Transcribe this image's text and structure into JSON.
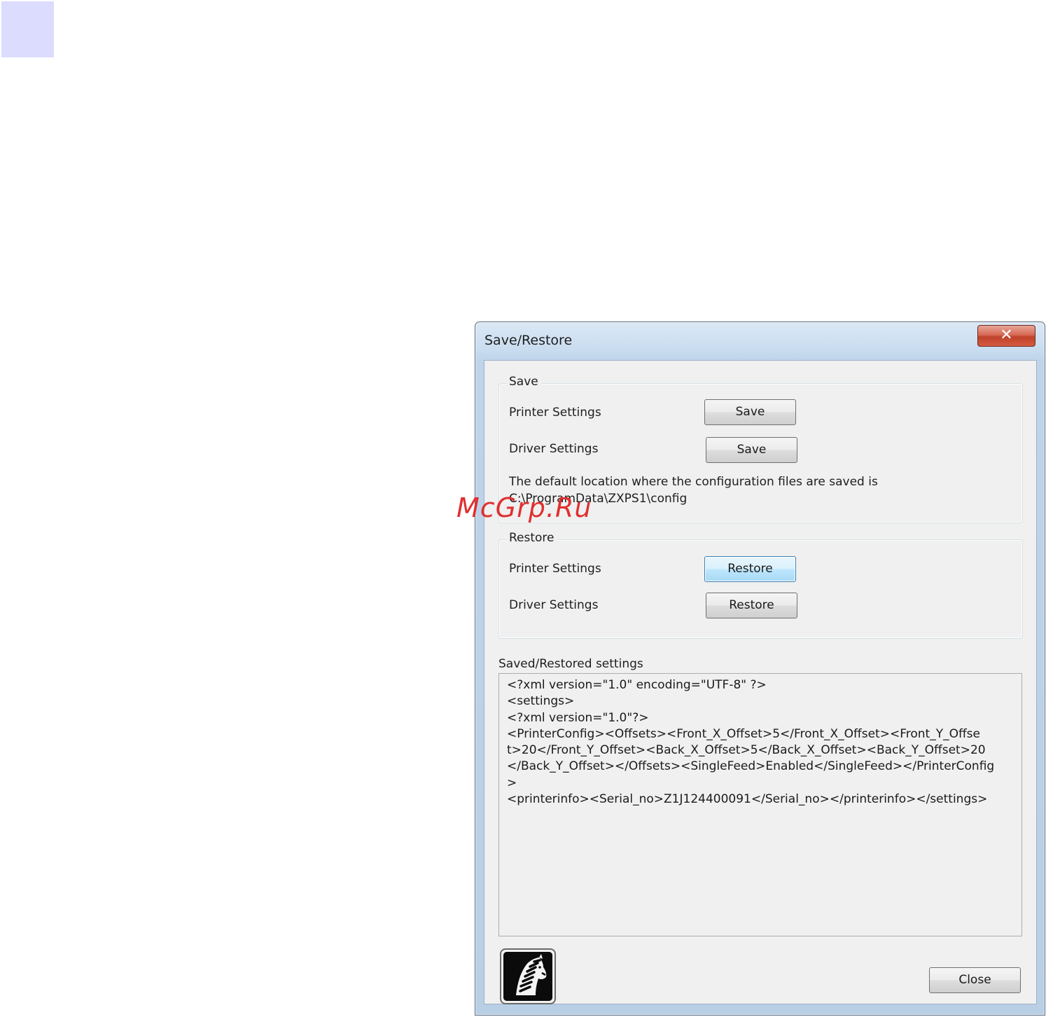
{
  "window": {
    "title": "Save/Restore",
    "close_glyph": "✕"
  },
  "save_group": {
    "legend": "Save",
    "printer_label": "Printer Settings",
    "printer_button": "Save",
    "driver_label": "Driver Settings",
    "driver_button": "Save",
    "note_line1": "The default location where the configuration files are saved is",
    "note_line2": "C:\\ProgramData\\ZXPS1\\config"
  },
  "restore_group": {
    "legend": "Restore",
    "printer_label": "Printer Settings",
    "printer_button": "Restore",
    "driver_label": "Driver Settings",
    "driver_button": "Restore"
  },
  "settings_output": {
    "label": "Saved/Restored settings",
    "lines": [
      "<?xml version=\"1.0\" encoding=\"UTF-8\" ?>",
      "<settings>",
      "<?xml version=\"1.0\"?>",
      "<PrinterConfig><Offsets><Front_X_Offset>5</Front_X_Offset><Front_Y_Offse",
      "t>20</Front_Y_Offset><Back_X_Offset>5</Back_X_Offset><Back_Y_Offset>20",
      "</Back_Y_Offset></Offsets><SingleFeed>Enabled</SingleFeed></PrinterConfig",
      ">",
      "<printerinfo><Serial_no>Z1J124400091</Serial_no></printerinfo></settings>"
    ]
  },
  "footer": {
    "logo_icon": "zebra-logo-icon",
    "close_button": "Close"
  },
  "watermark": {
    "text": "McGrp.Ru"
  },
  "colors": {
    "corner_square": "#dcdcff",
    "close_red": "#c0432b",
    "focused_button_blue": "#3c7fb1",
    "watermark_red": "#e03030"
  }
}
